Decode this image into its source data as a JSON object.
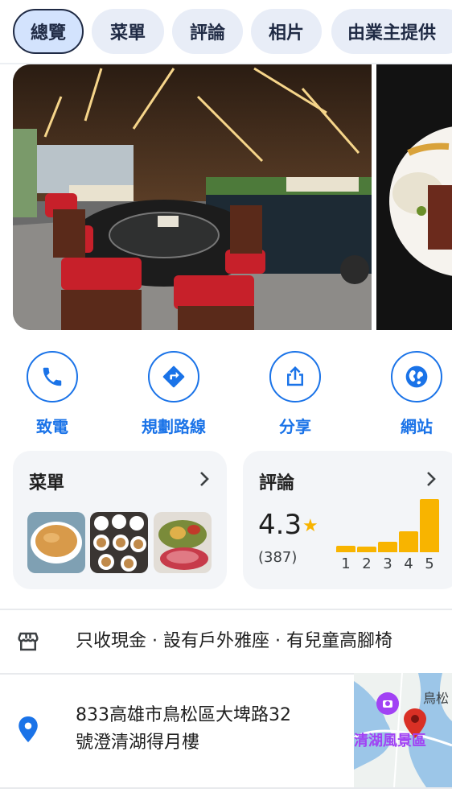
{
  "tabs": [
    "總覽",
    "菜單",
    "評論",
    "相片",
    "由業主提供"
  ],
  "actions": {
    "call": "致電",
    "directions": "規劃路線",
    "share": "分享",
    "website": "網站"
  },
  "menu_card": {
    "title": "菜單"
  },
  "reviews_card": {
    "title": "評論",
    "rating": "4.3",
    "count": "(387)",
    "histogram": {
      "labels": [
        "1",
        "2",
        "3",
        "4",
        "5"
      ],
      "relative": [
        0.12,
        0.1,
        0.2,
        0.4,
        1.0
      ]
    }
  },
  "attributes": "只收現金 · 設有戶外雅座 · 有兒童高腳椅",
  "address": {
    "line1": "833高雄市鳥松區大埤路32",
    "line2": "號澄清湖得月樓"
  },
  "map": {
    "label1": "鳥松",
    "label2": "清湖風景區"
  },
  "colors": {
    "accent": "#1a73e8",
    "star": "#f8b400",
    "pin": "#1a73e8",
    "map_pin": "#d93025"
  },
  "icons": [
    "phone-icon",
    "directions-icon",
    "share-icon",
    "globe-icon",
    "storefront-icon",
    "location-pin-icon",
    "chevron-right-icon",
    "star-icon"
  ]
}
